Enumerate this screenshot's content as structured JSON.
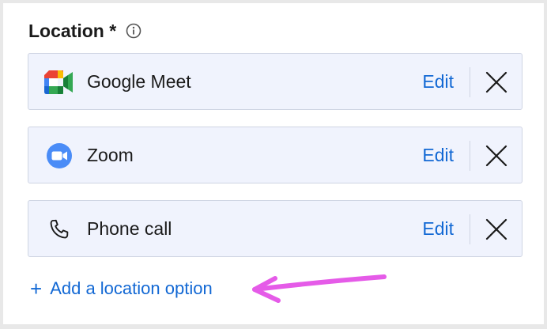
{
  "field": {
    "label": "Location *",
    "info_icon": "info-icon"
  },
  "locations": [
    {
      "name": "Google Meet",
      "icon": "google-meet-icon",
      "edit_label": "Edit",
      "remove_icon": "close-icon"
    },
    {
      "name": "Zoom",
      "icon": "zoom-icon",
      "edit_label": "Edit",
      "remove_icon": "close-icon"
    },
    {
      "name": "Phone call",
      "icon": "phone-icon",
      "edit_label": "Edit",
      "remove_icon": "close-icon"
    }
  ],
  "add_option": {
    "label": "Add a location option",
    "icon": "plus-icon"
  },
  "annotation": {
    "arrow_color": "#e55be8"
  },
  "colors": {
    "accent": "#1268d4",
    "row_background": "#f0f3fd",
    "row_border": "#cfd5e3"
  }
}
